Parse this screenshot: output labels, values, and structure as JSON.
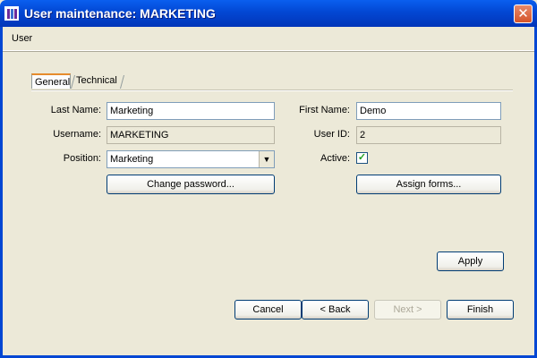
{
  "window": {
    "title": "User maintenance: MARKETING",
    "close_label": "✕"
  },
  "menu": {
    "user": "User"
  },
  "tabs": [
    {
      "label": "General"
    },
    {
      "label": "Technical"
    }
  ],
  "form": {
    "last_name_label": "Last Name:",
    "last_name_value": "Marketing",
    "first_name_label": "First Name:",
    "first_name_value": "Demo",
    "username_label": "Username:",
    "username_value": "MARKETING",
    "user_id_label": "User ID:",
    "user_id_value": "2",
    "position_label": "Position:",
    "position_value": "Marketing",
    "active_label": "Active:",
    "active_checked": true,
    "change_password": "Change password...",
    "assign_forms": "Assign forms..."
  },
  "buttons": {
    "apply": "Apply",
    "cancel": "Cancel",
    "back": "< Back",
    "next": "Next >",
    "finish": "Finish"
  }
}
